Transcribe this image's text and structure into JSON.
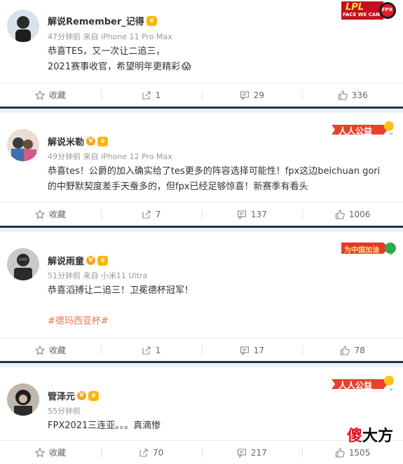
{
  "posts": [
    {
      "author": "解说Remember_记得",
      "meta": "47分钟前 来自 iPhone 11 Pro Max",
      "lines": [
        "恭喜TES，又一次让二追三，",
        "2021赛事收官，希望明年更精彩"
      ],
      "emoji": "😱",
      "tag_label": "LPL",
      "tag_sub": "FACE WE CAN",
      "tag_team": "FPX",
      "actions": {
        "fav": "收藏",
        "share": "1",
        "comment": "29",
        "like": "336"
      }
    },
    {
      "author": "解说米勒",
      "meta": "49分钟前 来自 iPhone 12 Pro Max",
      "lines": [
        "恭喜tes！公爵的加入确实给了tes更多的阵容选择可能性！fpx这边beichuan gori",
        "的中野默契度差手天蚕多的，但fpx已经足够惊喜！新赛季有看头"
      ],
      "tag_label": "人人公益",
      "actions": {
        "fav": "收藏",
        "share": "7",
        "comment": "137",
        "like": "1006"
      }
    },
    {
      "author": "解说雨童",
      "meta": "51分钟前 来自 小米11 Ultra",
      "lines": [
        "恭喜滔搏让二追三！卫冕德杯冠军！"
      ],
      "hashtag": "#德玛西亚杯#",
      "tag_label": "为中国加油",
      "actions": {
        "fav": "收藏",
        "share": "1",
        "comment": "17",
        "like": "78"
      }
    },
    {
      "author": "管泽元",
      "meta": "55分钟前",
      "lines": [
        "FPX2021三连亚。。。真滴惨"
      ],
      "tag_label": "人人公益",
      "actions": {
        "fav": "收藏",
        "share": "70",
        "comment": "217",
        "like": "1505"
      }
    }
  ],
  "badges": {
    "v": "V",
    "crown": "♛"
  },
  "watermark": {
    "red": "傻",
    "black": "大方"
  },
  "colors": {
    "divider": "#1a3550",
    "accent": "#eb7350",
    "orange": "#f5a623"
  }
}
